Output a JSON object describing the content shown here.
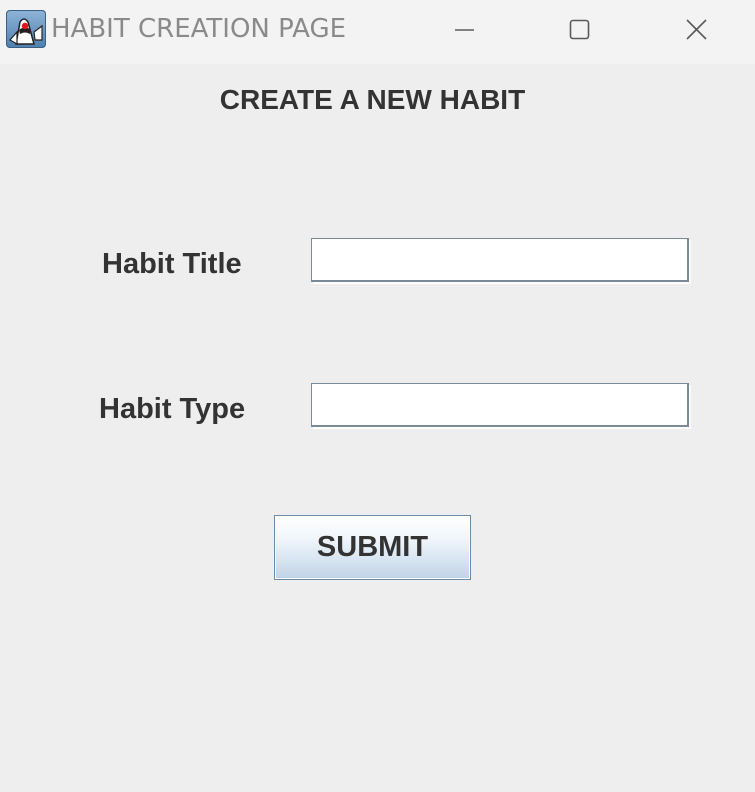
{
  "window": {
    "title": "HABIT CREATION PAGE",
    "controls": {
      "minimize": "minimize-icon",
      "maximize": "maximize-icon",
      "close": "close-icon"
    },
    "app_icon": "java-duke-icon"
  },
  "form": {
    "heading": "CREATE A NEW HABIT",
    "habit_title": {
      "label": "Habit Title",
      "value": "",
      "placeholder": ""
    },
    "habit_type": {
      "label": "Habit Type",
      "value": "",
      "placeholder": ""
    },
    "submit_label": "SUBMIT"
  },
  "colors": {
    "background": "#eeeeee",
    "titlebar": "#f3f3f3",
    "title_text": "#8a8a8a",
    "label_text": "#333333",
    "button_gradient_bottom": "#c0d3e7"
  }
}
